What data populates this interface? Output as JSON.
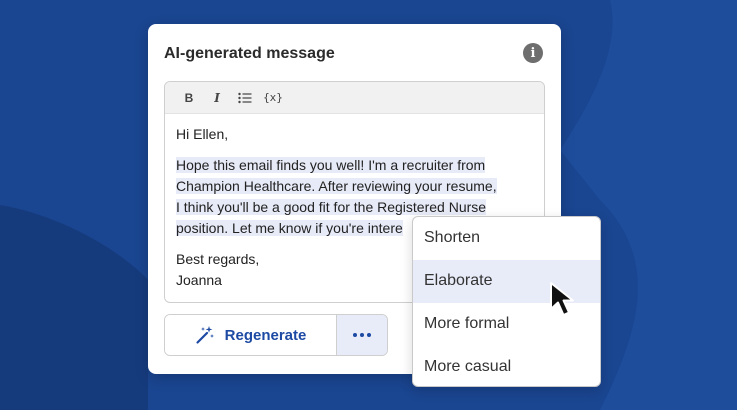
{
  "card": {
    "title": "AI-generated message",
    "info_icon": "info-icon"
  },
  "toolbar": {
    "bold_label": "B",
    "italic_label": "I",
    "list_icon": "bullet-list-icon",
    "variable_label": "{x}"
  },
  "message": {
    "greeting": "Hi Ellen,",
    "lines": [
      "Hope this email finds you well! I'm a recruiter from",
      "Champion Healthcare. After reviewing your resume,",
      "I think you'll be a good fit for the Registered Nurse",
      "position. Let me know if you're intere"
    ],
    "signoff": "Best regards,",
    "name": "Joanna"
  },
  "actions": {
    "regenerate_label": "Regenerate",
    "regenerate_icon": "magic-wand-icon",
    "more_icon": "more-horizontal-icon"
  },
  "menu": {
    "items": [
      "Shorten",
      "Elaborate",
      "More formal",
      "More casual"
    ],
    "active_index": 1
  },
  "colors": {
    "background": "#1a4590",
    "accent": "#1d4aa3",
    "highlight": "#e7eaf7"
  }
}
